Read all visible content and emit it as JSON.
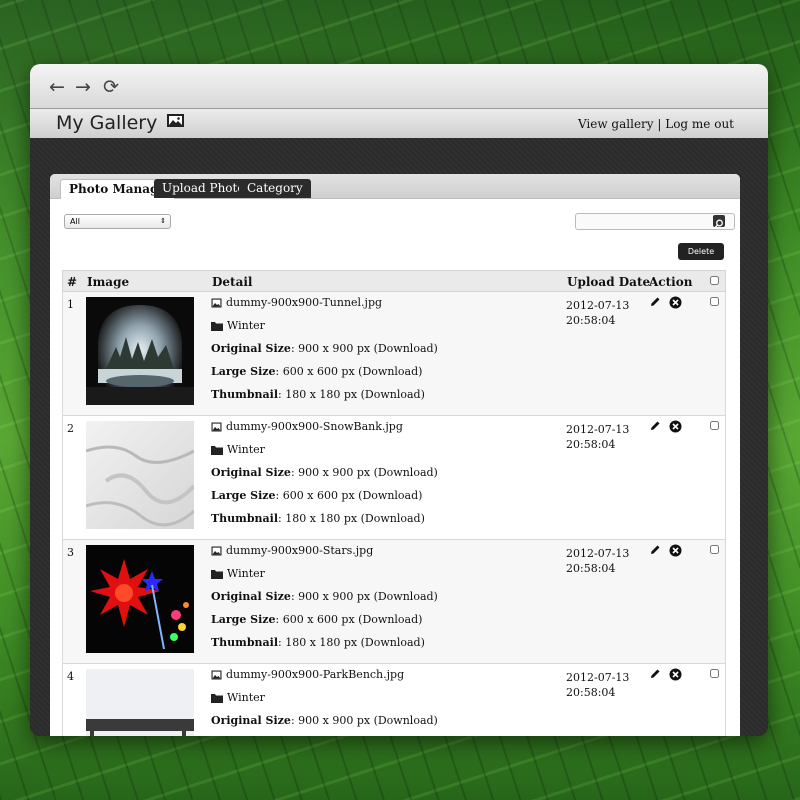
{
  "browser": {
    "back_icon": "arrow-left-icon",
    "forward_icon": "arrow-right-icon",
    "reload_icon": "reload-icon"
  },
  "header": {
    "title": "My Gallery",
    "title_icon": "picture-icon",
    "view_gallery": "View gallery",
    "separator": " | ",
    "logout": "Log me out"
  },
  "tabs": [
    {
      "label": "Photo Manage",
      "active": true
    },
    {
      "label": "Upload Photo",
      "active": false
    },
    {
      "label": "Category",
      "active": false
    }
  ],
  "filter": {
    "selected": "All"
  },
  "toolbar": {
    "delete_label": "Delete"
  },
  "table": {
    "headers": {
      "num": "#",
      "image": "Image",
      "detail": "Detail",
      "date": "Upload Date",
      "action": "Action"
    },
    "labels": {
      "original": "Original Size",
      "large": "Large Size",
      "thumbnail": "Thumbnail"
    },
    "rows": [
      {
        "num": "1",
        "filename": "dummy-900x900-Tunnel.jpg",
        "category": "Winter",
        "original": ": 900 x 900 px (Download)",
        "large": ": 600 x 600 px (Download)",
        "thumbnail": ": 180 x 180 px (Download)",
        "date": "2012-07-13",
        "time": "20:58:04"
      },
      {
        "num": "2",
        "filename": "dummy-900x900-SnowBank.jpg",
        "category": "Winter",
        "original": ": 900 x 900 px (Download)",
        "large": ": 600 x 600 px (Download)",
        "thumbnail": ": 180 x 180 px (Download)",
        "date": "2012-07-13",
        "time": "20:58:04"
      },
      {
        "num": "3",
        "filename": "dummy-900x900-Stars.jpg",
        "category": "Winter",
        "original": ": 900 x 900 px (Download)",
        "large": ": 600 x 600 px (Download)",
        "thumbnail": ": 180 x 180 px (Download)",
        "date": "2012-07-13",
        "time": "20:58:04"
      },
      {
        "num": "4",
        "filename": "dummy-900x900-ParkBench.jpg",
        "category": "Winter",
        "original": ": 900 x 900 px (Download)",
        "large": "",
        "thumbnail": "",
        "date": "2012-07-13",
        "time": "20:58:04"
      }
    ]
  }
}
